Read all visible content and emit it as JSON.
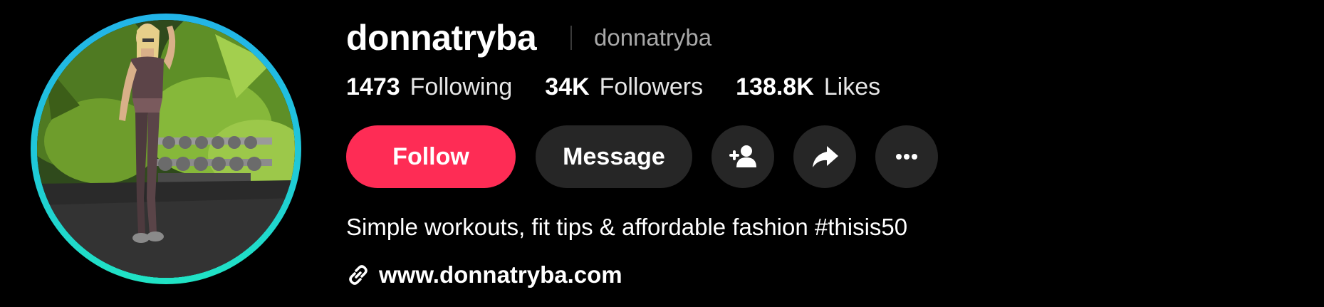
{
  "profile": {
    "username": "donnatryba",
    "nickname": "donnatryba",
    "bio": "Simple workouts, fit tips & affordable fashion #thisis50",
    "link": "www.donnatryba.com",
    "avatar_alt": "profile photo"
  },
  "stats": [
    {
      "value": "1473",
      "label": "Following"
    },
    {
      "value": "34K",
      "label": "Followers"
    },
    {
      "value": "138.8K",
      "label": "Likes"
    }
  ],
  "actions": {
    "follow_label": "Follow",
    "message_label": "Message",
    "add_friend_icon": "add-user-icon",
    "share_icon": "share-icon",
    "more_icon": "more-icon"
  },
  "colors": {
    "follow_button": "#fe2c55",
    "secondary_button": "#262626",
    "avatar_ring_top": "#22b4e8",
    "avatar_ring_bottom": "#20e3c4"
  }
}
